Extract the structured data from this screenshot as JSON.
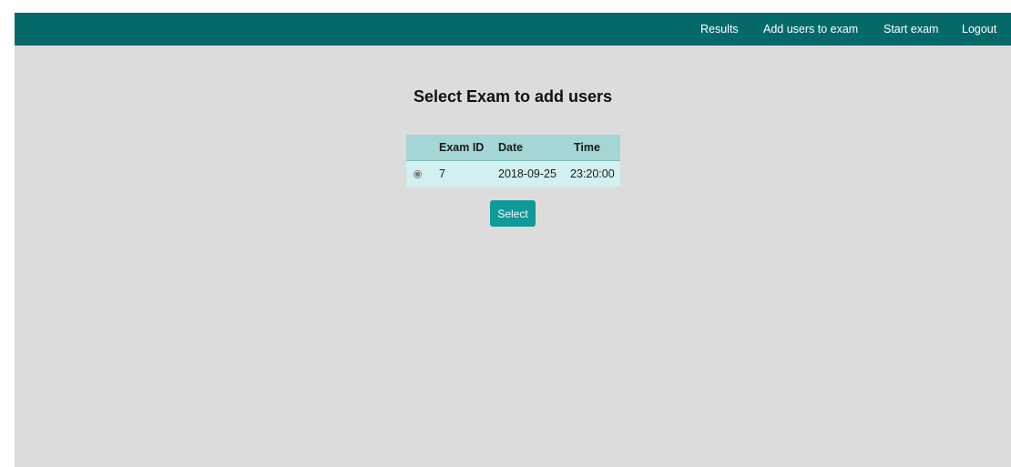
{
  "nav": {
    "items": [
      {
        "label": "Results"
      },
      {
        "label": "Add users to exam"
      },
      {
        "label": "Start exam"
      },
      {
        "label": "Logout"
      }
    ]
  },
  "main": {
    "title": "Select Exam to add users",
    "table": {
      "headers": [
        "",
        "Exam ID",
        "Date",
        "Time"
      ],
      "rows": [
        {
          "selected": true,
          "exam_id": "7",
          "date": "2018-09-25",
          "time": "23:20:00"
        }
      ]
    },
    "select_button": "Select"
  },
  "colors": {
    "navbar": "#056969",
    "background": "#dcdcdd",
    "table_header": "#a4d6d6",
    "table_row": "#d3f0f0",
    "button": "#0f9999"
  }
}
